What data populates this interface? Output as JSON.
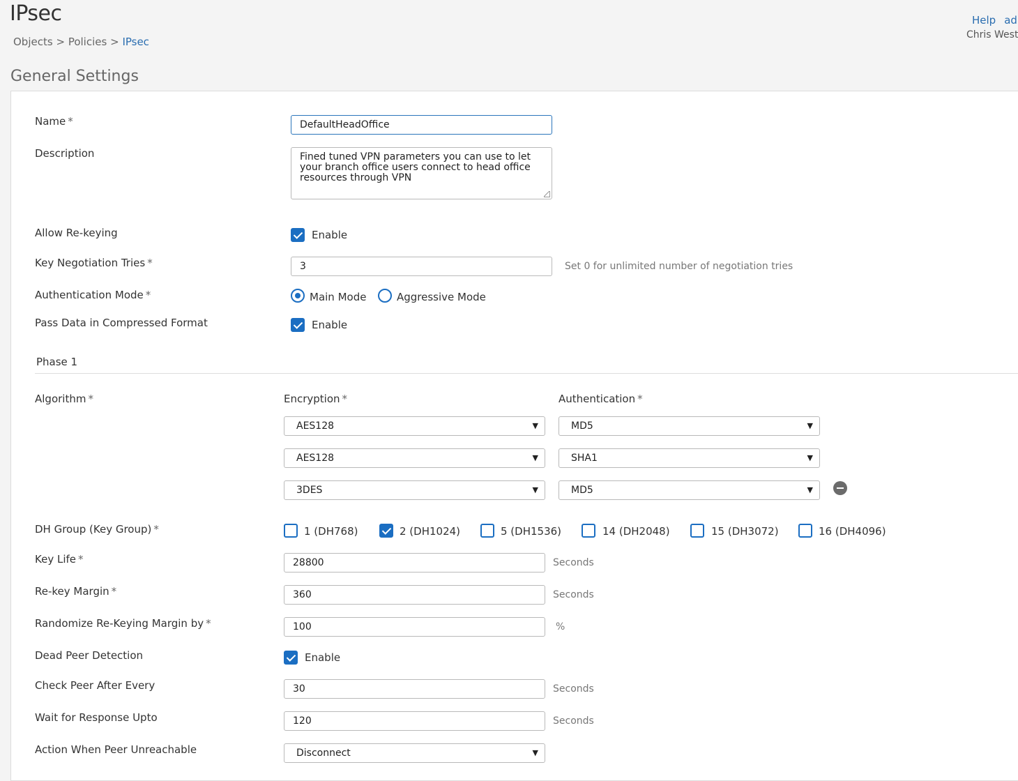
{
  "header": {
    "title": "IPsec",
    "breadcrumb": [
      "Objects",
      "Policies",
      "IPsec"
    ],
    "breadcrumb_sep": ">",
    "help_link": "Help",
    "extra_link": "ad",
    "user": "Chris West"
  },
  "section_title": "General Settings",
  "form": {
    "name": {
      "label": "Name",
      "value": "DefaultHeadOffice"
    },
    "description": {
      "label": "Description",
      "value": "Fined tuned VPN parameters you can use to let your branch office users connect to head office resources through VPN"
    },
    "allow_rekeying": {
      "label": "Allow Re-keying",
      "option": "Enable",
      "checked": true
    },
    "key_negotiation_tries": {
      "label": "Key Negotiation Tries",
      "value": "3",
      "hint": "Set 0 for unlimited number of negotiation tries"
    },
    "auth_mode": {
      "label": "Authentication Mode",
      "options": [
        "Main Mode",
        "Aggressive Mode"
      ],
      "selected": "Main Mode"
    },
    "compressed": {
      "label": "Pass Data in Compressed Format",
      "option": "Enable",
      "checked": true
    }
  },
  "phase1": {
    "title": "Phase 1",
    "algorithm_label": "Algorithm",
    "encryption_header": "Encryption",
    "authentication_header": "Authentication",
    "rows": [
      {
        "encryption": "AES128",
        "authentication": "MD5"
      },
      {
        "encryption": "AES128",
        "authentication": "SHA1"
      },
      {
        "encryption": "3DES",
        "authentication": "MD5"
      }
    ],
    "dh_group": {
      "label": "DH Group (Key Group)",
      "options": [
        {
          "label": "1 (DH768)",
          "checked": false
        },
        {
          "label": "2 (DH1024)",
          "checked": true
        },
        {
          "label": "5 (DH1536)",
          "checked": false
        },
        {
          "label": "14 (DH2048)",
          "checked": false
        },
        {
          "label": "15 (DH3072)",
          "checked": false
        },
        {
          "label": "16 (DH4096)",
          "checked": false
        }
      ]
    },
    "key_life": {
      "label": "Key Life",
      "value": "28800",
      "unit": "Seconds"
    },
    "rekey_margin": {
      "label": "Re-key Margin",
      "value": "360",
      "unit": "Seconds"
    },
    "randomize": {
      "label": "Randomize Re-Keying Margin by",
      "value": "100",
      "unit": "%"
    },
    "dpd": {
      "label": "Dead Peer Detection",
      "option": "Enable",
      "checked": true
    },
    "check_peer": {
      "label": "Check Peer After Every",
      "value": "30",
      "unit": "Seconds"
    },
    "wait_response": {
      "label": "Wait for Response Upto",
      "value": "120",
      "unit": "Seconds"
    },
    "action_unreachable": {
      "label": "Action When Peer Unreachable",
      "value": "Disconnect"
    }
  },
  "required_mark": "*",
  "caret": "▼",
  "accent_color": "#1b6ec2"
}
